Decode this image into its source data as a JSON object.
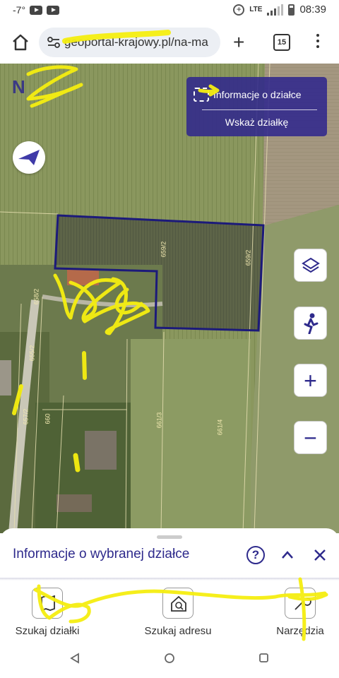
{
  "status_bar": {
    "temperature": "-7°",
    "network": "LTE",
    "network_index": "2",
    "time": "08:39"
  },
  "browser": {
    "url": "geoportal-krajowy.pl/na-ma",
    "tab_count": "15"
  },
  "map": {
    "brand_text": "N",
    "info_panel": {
      "parcel_info_label": "Informacje o działce",
      "select_parcel_label": "Wskaż działkę"
    },
    "parcel_labels": [
      "659/2",
      "659/2",
      "658/2",
      "655/2",
      "657/2",
      "660",
      "661/3",
      "661/4"
    ]
  },
  "bottom_sheet": {
    "title": "Informacje o wybranej działce",
    "help_symbol": "?"
  },
  "bottom_nav": {
    "items": [
      {
        "label": "Szukaj działki",
        "icon": "map-search-icon"
      },
      {
        "label": "Szukaj adresu",
        "icon": "address-search-icon"
      },
      {
        "label": "Narzędzia",
        "icon": "tools-icon"
      }
    ]
  },
  "colors": {
    "accent": "#2e2a8c",
    "panel_bg": "#30288c",
    "parcel_outline": "#1c1a7a",
    "scribble": "#f5ee10"
  }
}
